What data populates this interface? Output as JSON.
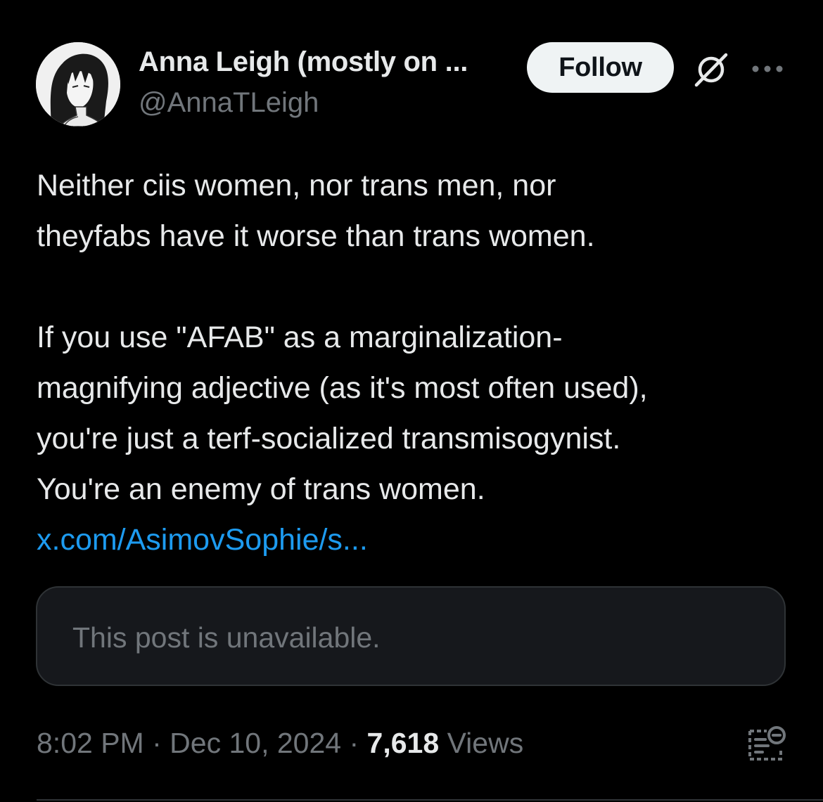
{
  "author": {
    "display_name": "Anna Leigh (mostly on ...",
    "handle": "@AnnaTLeigh",
    "avatar_icon": "manga-portrait-avatar"
  },
  "actions": {
    "follow_label": "Follow",
    "grok_icon": "grok-icon",
    "more_icon": "more-dots-icon"
  },
  "post": {
    "lines_1": [
      "Neither ciis women, nor trans men, nor",
      "theyfabs have it worse than trans women."
    ],
    "lines_2": [
      "If you use \"AFAB\" as a marginalization-",
      "magnifying adjective (as it's most often used),",
      "you're just a terf-socialized transmisogynist.",
      "You're an enemy of trans women."
    ],
    "link_text": "x.com/AsimovSophie/s..."
  },
  "quote": {
    "text": "This post is unavailable."
  },
  "meta": {
    "time": "8:02 PM",
    "separator": "·",
    "date": "Dec 10, 2024",
    "views_count": "7,618",
    "views_label": "Views",
    "analytics_icon": "analytics-icon"
  },
  "colors": {
    "background": "#000000",
    "text_primary": "#e7e9ea",
    "text_secondary": "#71767b",
    "link": "#1d9bf0",
    "follow_button_bg": "#eff3f4",
    "quote_bg": "#16181c",
    "border": "#2f3336"
  }
}
